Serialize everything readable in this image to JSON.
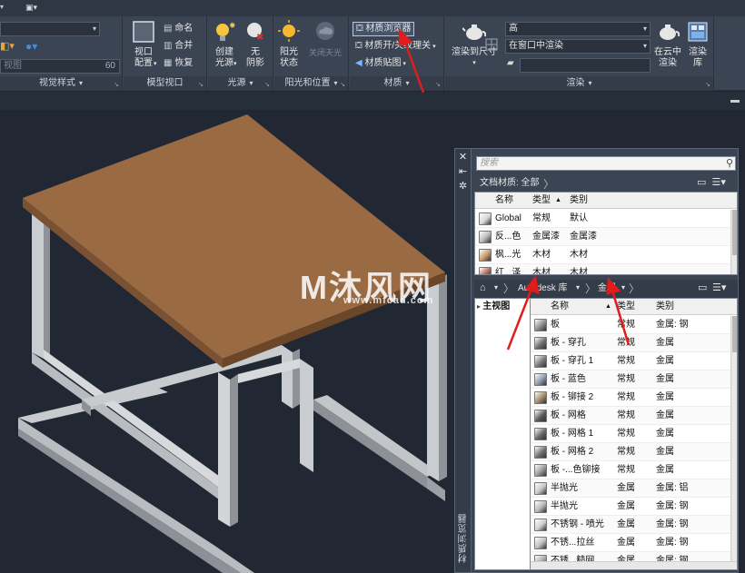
{
  "ribbon": {
    "panels": {
      "visual_styles": {
        "title": "视觉样式",
        "input_value": "视图",
        "input_number": "60"
      },
      "model_viewport": {
        "title": "模型视口",
        "viewport_config": "视口\n配置",
        "name": "命名",
        "join": "合并",
        "restore": "恢复"
      },
      "lights": {
        "title": "光源",
        "create_light": "创建\n光源",
        "no_shadow": "无\n阴影"
      },
      "sun_location": {
        "title": "阳光和位置",
        "sun_status": "阳光\n状态",
        "sky_off": "关闭天光"
      },
      "materials": {
        "title": "材质",
        "material_browser": "材质浏览器",
        "material_on_off": "材质开/关",
        "texture_related": "纹理关",
        "material_mapping": "材质贴图"
      },
      "render": {
        "title": "渲染",
        "render_to_size": "渲染到尺寸",
        "quality": "高",
        "render_in": "在窗口中渲染",
        "cloud_render": "在云中\n渲染",
        "render_library": "渲染\n库"
      }
    }
  },
  "watermark": {
    "main": "沐风网",
    "sub": "www.mfcad.com"
  },
  "material_browser": {
    "title": "材质浏览器",
    "search_placeholder": "搜索",
    "doc_crumb": "文档材质: 全部",
    "doc_columns": {
      "name": "名称",
      "type": "类型",
      "category": "类别"
    },
    "doc_rows": [
      {
        "name": "Global",
        "type": "常规",
        "category": "默认",
        "color": "#d8d8d8"
      },
      {
        "name": "反...色",
        "type": "金属漆",
        "category": "金属漆",
        "color": "#b9b9b9"
      },
      {
        "name": "枫...光",
        "type": "木材",
        "category": "木材",
        "color": "#c89a6a"
      },
      {
        "name": "红...泽",
        "type": "木材",
        "category": "木材",
        "color": "#b5654a"
      }
    ],
    "lib_crumbs": {
      "library": "Autodesk 库",
      "folder": "金属"
    },
    "tree_root": "主视图",
    "lib_columns": {
      "name": "名称",
      "type": "类型",
      "category": "类别"
    },
    "lib_rows": [
      {
        "name": "板",
        "type": "常规",
        "category": "金属: 钢",
        "color": "#8a8a8a"
      },
      {
        "name": "板 - 穿孔",
        "type": "常规",
        "category": "金属",
        "color": "#6e6e6e"
      },
      {
        "name": "板 - 穿孔 1",
        "type": "常规",
        "category": "金属",
        "color": "#7a7a7a"
      },
      {
        "name": "板 - 蓝色",
        "type": "常规",
        "category": "金属",
        "color": "#8d9cae"
      },
      {
        "name": "板 - 铆接 2",
        "type": "常规",
        "category": "金属",
        "color": "#a08a6a"
      },
      {
        "name": "板 - 网格",
        "type": "常规",
        "category": "金属",
        "color": "#5a5a5a"
      },
      {
        "name": "板 - 网格 1",
        "type": "常规",
        "category": "金属",
        "color": "#666666"
      },
      {
        "name": "板 - 网格 2",
        "type": "常规",
        "category": "金属",
        "color": "#707070"
      },
      {
        "name": "板 -...色铆接",
        "type": "常规",
        "category": "金属",
        "color": "#9a9a9a"
      },
      {
        "name": "半抛光",
        "type": "金属",
        "category": "金属: 铝",
        "color": "#c8c8c8"
      },
      {
        "name": "半抛光",
        "type": "金属",
        "category": "金属: 钢",
        "color": "#b8b8b8"
      },
      {
        "name": "不锈钢 - 喷光",
        "type": "金属",
        "category": "金属: 钢",
        "color": "#cfcfcf"
      },
      {
        "name": "不锈...拉丝",
        "type": "金属",
        "category": "金属: 钢",
        "color": "#c0c0c0"
      },
      {
        "name": "不锈...糙网",
        "type": "金属",
        "category": "金属: 钢",
        "color": "#a9a9a9"
      }
    ]
  }
}
